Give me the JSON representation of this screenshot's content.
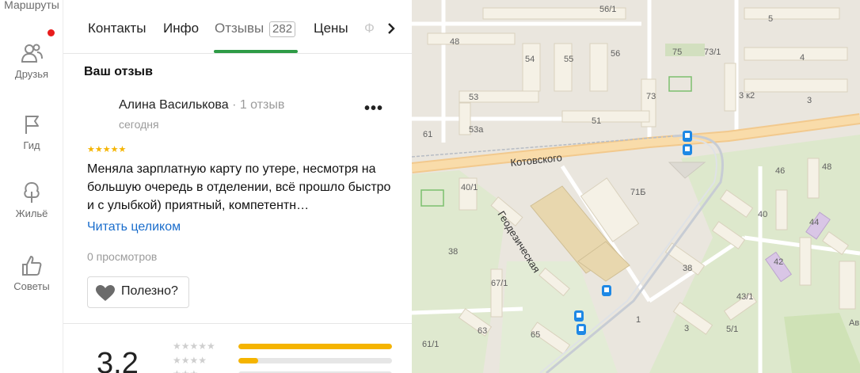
{
  "rail": {
    "routes_label": "Маршруты",
    "friends_label": "Друзья",
    "guide_label": "Гид",
    "housing_label": "Жильё",
    "tips_label": "Советы"
  },
  "tabs": {
    "contacts": "Контакты",
    "info": "Инфо",
    "reviews": "Отзывы",
    "reviews_count": "282",
    "prices": "Цены",
    "photos_faded": "Ф"
  },
  "review": {
    "section_title": "Ваш отзыв",
    "author": "Алина Василькова",
    "author_meta": "· 1 отзыв",
    "date": "сегодня",
    "rating": 5,
    "stars": "★★★★★",
    "text": "Меняла зарплатную карту по утере, несмотря на большую очередь в отделении, всё прошло быстро и с улыбкой) приятный, компетентн…",
    "read_more": "Читать целиком",
    "views": "0 просмотров",
    "useful": "Полезно?"
  },
  "summary": {
    "rating": "3.2",
    "rows": [
      {
        "stars": "★★★★★",
        "fraction": 1.0
      },
      {
        "stars": "★★★★",
        "fraction": 0.13
      },
      {
        "stars": "★★★",
        "fraction": 0.0
      }
    ]
  },
  "map": {
    "street_kotovskogo": "Котовского",
    "street_geodezicheskaya": "Геодезическая",
    "house_numbers": [
      "56/1",
      "48",
      "54",
      "55",
      "56",
      "75",
      "73/1",
      "5",
      "4",
      "53",
      "53а",
      "51",
      "73",
      "3 к2",
      "3",
      "61",
      "46",
      "48",
      "40/1",
      "71Б",
      "40",
      "44",
      "42",
      "38",
      "67/1",
      "38",
      "43/1",
      "63",
      "65",
      "1",
      "3",
      "5/1",
      "61/1",
      "Ав"
    ]
  },
  "colors": {
    "accent_green": "#2e9b46",
    "link_blue": "#1a6dcc",
    "star_yellow": "#f5b400",
    "notify_red": "#e81c1c"
  }
}
